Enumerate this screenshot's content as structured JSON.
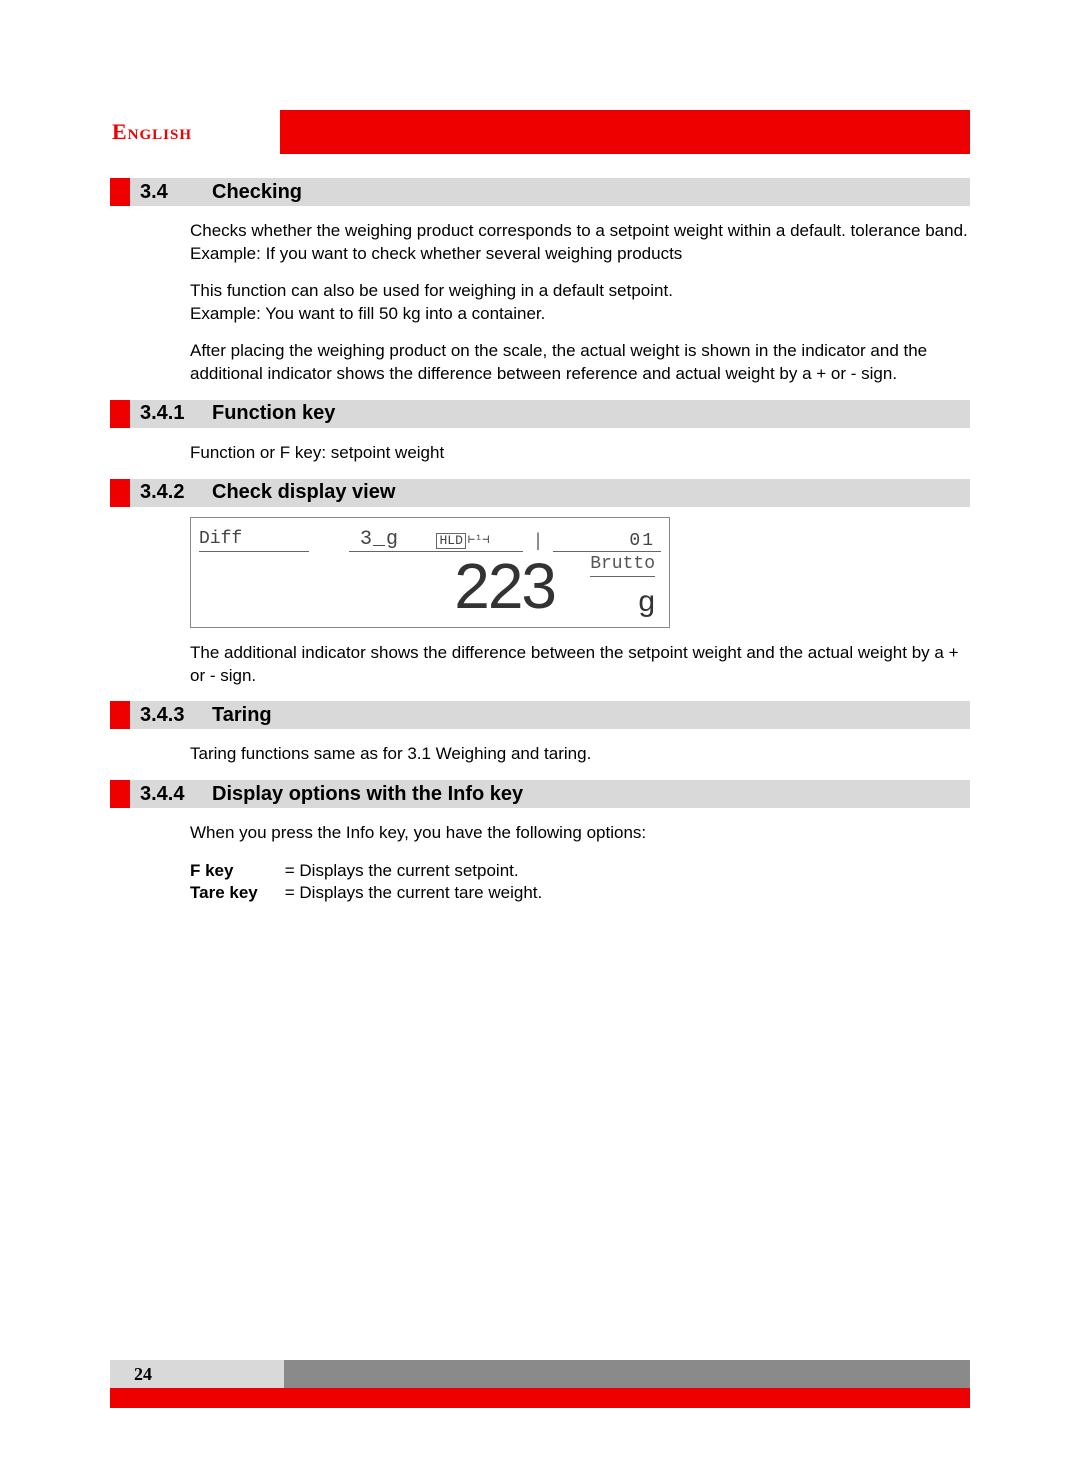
{
  "language_label": "English",
  "sections": {
    "s34": {
      "num": "3.4",
      "title": "Checking"
    },
    "s341": {
      "num": "3.4.1",
      "title": "Function key"
    },
    "s342": {
      "num": "3.4.2",
      "title": "Check display view"
    },
    "s343": {
      "num": "3.4.3",
      "title": "Taring"
    },
    "s344": {
      "num": "3.4.4",
      "title": "Display options with the Info key"
    }
  },
  "paragraphs": {
    "p1": "Checks whether the weighing product corresponds to a setpoint weight within a default. tolerance band. Example: If you want to check whether several weighing products",
    "p2": "This function can also be used for weighing in a default setpoint.\nExample: You want to fill 50 kg into a container.",
    "p3": "After placing the weighing product on the scale, the actual weight is shown in the indicator and the additional indicator shows the difference between reference and actual weight by a + or - sign.",
    "p341": "Function or F key: setpoint weight",
    "p342_after": "The additional indicator shows the difference between the setpoint weight and the actual weight by a + or - sign.",
    "p343": "Taring functions same as for 3.1 Weighing and taring.",
    "p344_intro": "When you press the Info key, you have the following options:"
  },
  "display": {
    "diff_label": "Diff",
    "small_val": "3_g",
    "hld": "HLD",
    "range_marker": "⊢¹⊣",
    "index": "01",
    "brutto": "Brutto",
    "main_value": "223",
    "unit": "g"
  },
  "options": [
    {
      "key": "F key",
      "desc": "= Displays the current setpoint."
    },
    {
      "key": "Tare key",
      "desc": "= Displays the current tare weight."
    }
  ],
  "page_number": "24"
}
